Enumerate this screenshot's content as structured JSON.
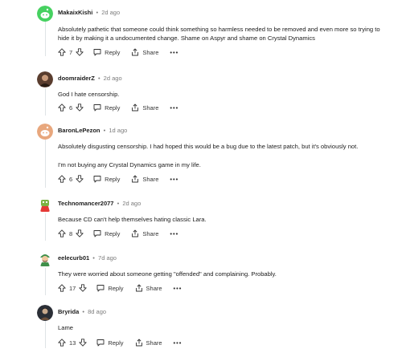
{
  "comments": [
    {
      "author": "MakaixKishi",
      "age": "2d ago",
      "avatar_color": "#46d160",
      "paragraphs": [
        "Absolutely pathetic that someone could think something so harmless needed to be removed and even more so trying to hide it by making it a undocumented change. Shame on Aspyr and shame on Crystal Dynamics"
      ],
      "votes": "7",
      "reply_label": "Reply",
      "share_label": "Share",
      "more_label": "•••"
    },
    {
      "author": "doomraiderZ",
      "age": "2d ago",
      "avatar_color": "#5a3d2e",
      "paragraphs": [
        "God I hate censorship."
      ],
      "votes": "6",
      "reply_label": "Reply",
      "share_label": "Share",
      "more_label": "•••"
    },
    {
      "author": "BaronLePezon",
      "age": "1d ago",
      "avatar_color": "#e8a77d",
      "paragraphs": [
        "Absolutely disgusting censorship. I had hoped this would be a bug due to the latest patch, but it's obviously not.",
        "I'm not buying any Crystal Dynamics game in my life."
      ],
      "votes": "6",
      "reply_label": "Reply",
      "share_label": "Share",
      "more_label": "•••"
    },
    {
      "author": "Technomancer2077",
      "age": "2d ago",
      "avatar_color": "#7cb342",
      "paragraphs": [
        "Because CD can't help themselves hating classic Lara."
      ],
      "votes": "8",
      "reply_label": "Reply",
      "share_label": "Share",
      "more_label": "•••"
    },
    {
      "author": "eelecurb01",
      "age": "7d ago",
      "avatar_color": "#3f8f4a",
      "paragraphs": [
        "They were worried about someone getting \"offended\" and complaining. Probably."
      ],
      "votes": "17",
      "reply_label": "Reply",
      "share_label": "Share",
      "more_label": "•••"
    },
    {
      "author": "Bryrida",
      "age": "8d ago",
      "avatar_color": "#2b2f36",
      "paragraphs": [
        "Lame"
      ],
      "votes": "13",
      "reply_label": "Reply",
      "share_label": "Share",
      "more_label": "•••"
    }
  ]
}
